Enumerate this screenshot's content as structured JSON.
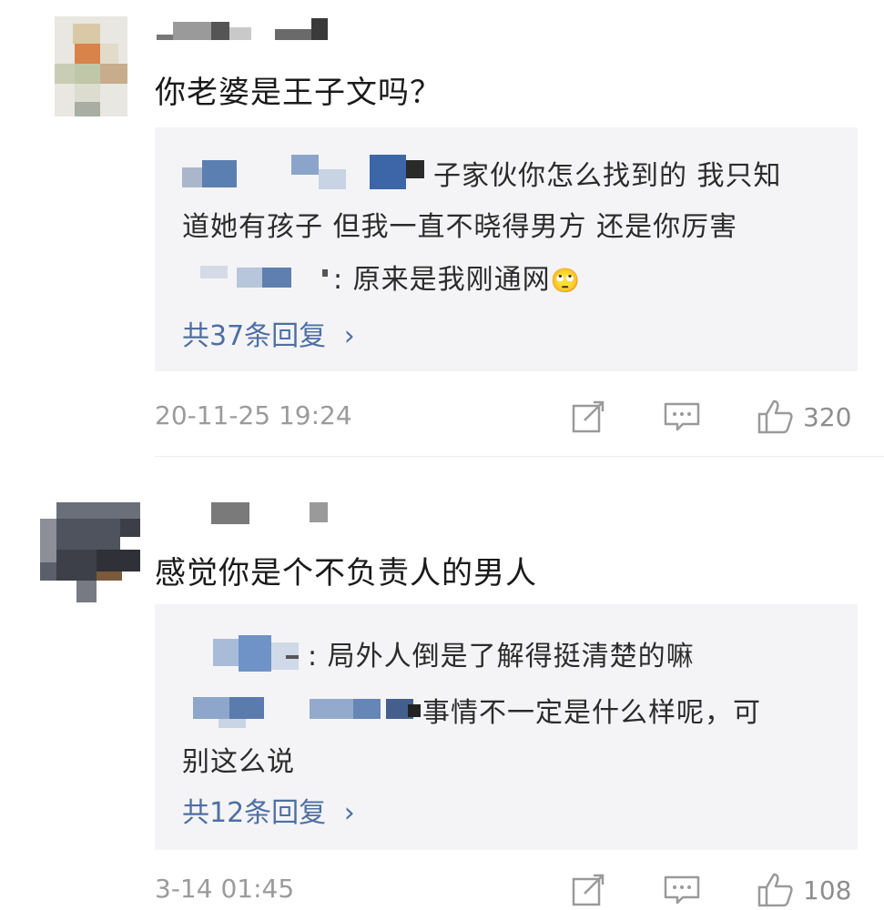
{
  "comments": [
    {
      "text": "你老婆是王子文吗？",
      "replies": [
        {
          "text_a": "子家伙你怎么找到的 我只知",
          "text_b": "道她有孩子 但我一直不晓得男方 还是你厉害"
        },
        {
          "text": "原来是我刚通网"
        }
      ],
      "reply_emoji": "🙄",
      "reply_count_label": "共37条回复",
      "reply_count_arrow": "›",
      "timestamp": "20-11-25 19:24",
      "like_count": "320"
    },
    {
      "text": "感觉你是个不负责人的男人",
      "replies": [
        {
          "text": "局外人倒是了解得挺清楚的嘛"
        },
        {
          "text_a": "事情不一定是什么样呢，可",
          "text_b": "别这么说"
        }
      ],
      "reply_count_label": "共12条回复",
      "reply_count_arrow": "›",
      "timestamp": "3-14 01:45",
      "like_count": "108"
    }
  ],
  "colors": {
    "link_blue": "#4e6fa3",
    "reply_bg": "#f4f4f6",
    "muted": "#9b9b9b"
  },
  "icons": [
    "share-icon",
    "comment-icon",
    "like-thumb-icon"
  ]
}
